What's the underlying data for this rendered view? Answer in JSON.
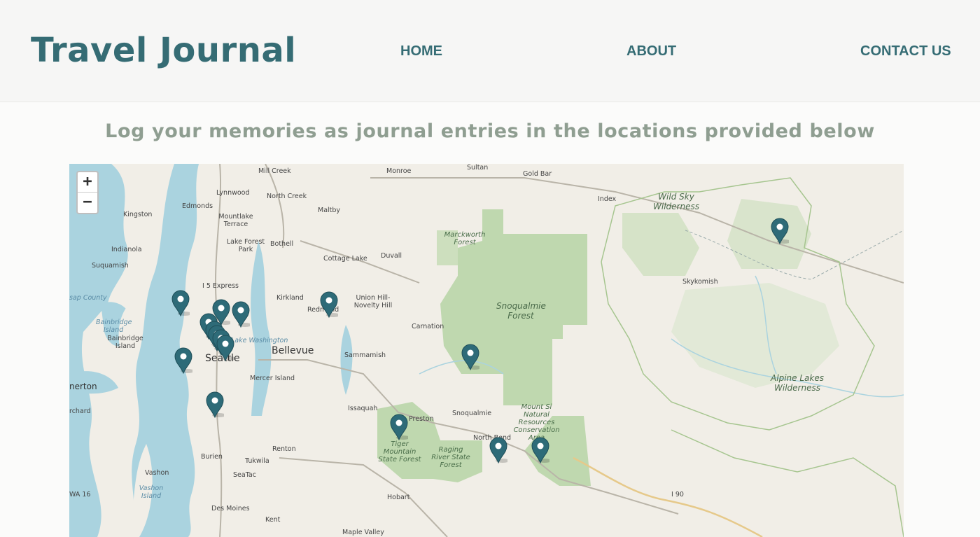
{
  "header": {
    "brand": "Travel Journal",
    "nav": {
      "home": "HOME",
      "about": "ABOUT",
      "contact": "CONTACT US"
    }
  },
  "tagline": "Log your memories as journal entries in the locations provided below",
  "map": {
    "zoom_in": "+",
    "zoom_out": "−",
    "labels": {
      "mill_creek": "Mill Creek",
      "monroe": "Monroe",
      "sultan": "Sultan",
      "gold_bar": "Gold Bar",
      "lynnwood": "Lynnwood",
      "north_creek": "North Creek",
      "index": "Index",
      "wild_sky": "Wild Sky Wilderness",
      "kingston": "Kingston",
      "edmonds": "Edmonds",
      "mountlake": "Mountlake Terrace",
      "maltby": "Maltby",
      "marckworth": "Marckworth Forest",
      "lake_forest": "Lake Forest Park",
      "bothell": "Bothell",
      "indianola": "Indianola",
      "duvall": "Duvall",
      "suquamish": "Suquamish",
      "cottage_lake": "Cottage Lake",
      "i5": "I 5 Express",
      "skykomish": "Skykomish",
      "kitsap": "sap County",
      "kirkland": "Kirkland",
      "redmond": "Redmond",
      "union_hill": "Union Hill-Novelty Hill",
      "snoqualmie_forest": "Snoqualmie Forest",
      "bainbridge_isl": "Bainbridge Island",
      "bainbridge": "Bainbridge Island",
      "carnation": "Carnation",
      "lake_washington": "Lake Washington",
      "bellevue": "Bellevue",
      "seattle": "Seattle",
      "sammamish": "Sammamish",
      "alpine": "Alpine Lakes Wilderness",
      "nerton": "nerton",
      "mercer": "Mercer Island",
      "issaquah": "Issaquah",
      "snoqualmie": "Snoqualmie",
      "preston": "Preston",
      "rchard": "rchard",
      "mount_si": "Mount Si Natural Resources Conservation Area",
      "tiger": "Tiger Mountain State Forest",
      "north_bend": "North Bend",
      "raging": "Raging River State Forest",
      "renton": "Renton",
      "burien": "Burien",
      "tukwila": "Tukwila",
      "vashon": "Vashon",
      "seatac": "SeaTac",
      "vashon_island": "Vashon Island",
      "wa16": "WA 16",
      "hobart": "Hobart",
      "i90": "I 90",
      "des_moines": "Des Moines",
      "kent": "Kent",
      "maple_valley": "Maple Valley"
    },
    "pin_count": 16
  }
}
